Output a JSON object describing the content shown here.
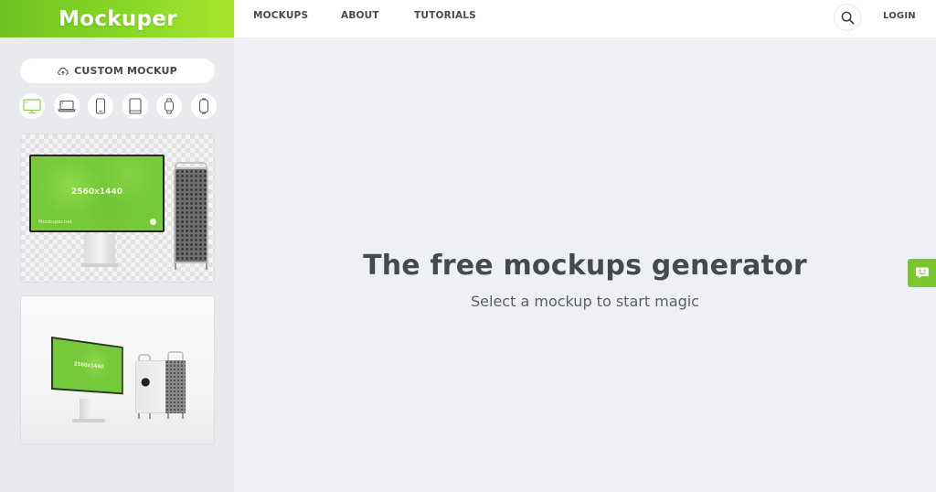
{
  "brand": {
    "logo": "Mockuper",
    "accent": "#7bc530"
  },
  "nav": {
    "items": [
      {
        "label": "MOCKUPS"
      },
      {
        "label": "ABOUT"
      },
      {
        "label": "TUTORIALS"
      }
    ],
    "search_icon": "search-icon",
    "login_label": "LOGIN"
  },
  "sidebar": {
    "custom_mockup_label": "CUSTOM MOCKUP",
    "custom_mockup_icon": "cloud-upload-icon",
    "device_filters": [
      {
        "name": "desktop",
        "icon": "monitor-icon",
        "active": true
      },
      {
        "name": "laptop",
        "icon": "laptop-icon",
        "active": false
      },
      {
        "name": "phone",
        "icon": "phone-icon",
        "active": false
      },
      {
        "name": "tablet",
        "icon": "tablet-icon",
        "active": false
      },
      {
        "name": "watch",
        "icon": "watch-icon",
        "active": false
      },
      {
        "name": "other",
        "icon": "rounded-device-icon",
        "active": false
      }
    ],
    "mockups": [
      {
        "screen_resolution": "2560x1440",
        "screen_brand": "Mockuper.net"
      },
      {
        "screen_resolution": "2560x1440",
        "screen_brand": "Mockuper.net"
      }
    ]
  },
  "main": {
    "title": "The free mockups generator",
    "subtitle": "Select a mockup to start magic"
  },
  "feedback": {
    "icon": "smiley-chat-icon"
  }
}
